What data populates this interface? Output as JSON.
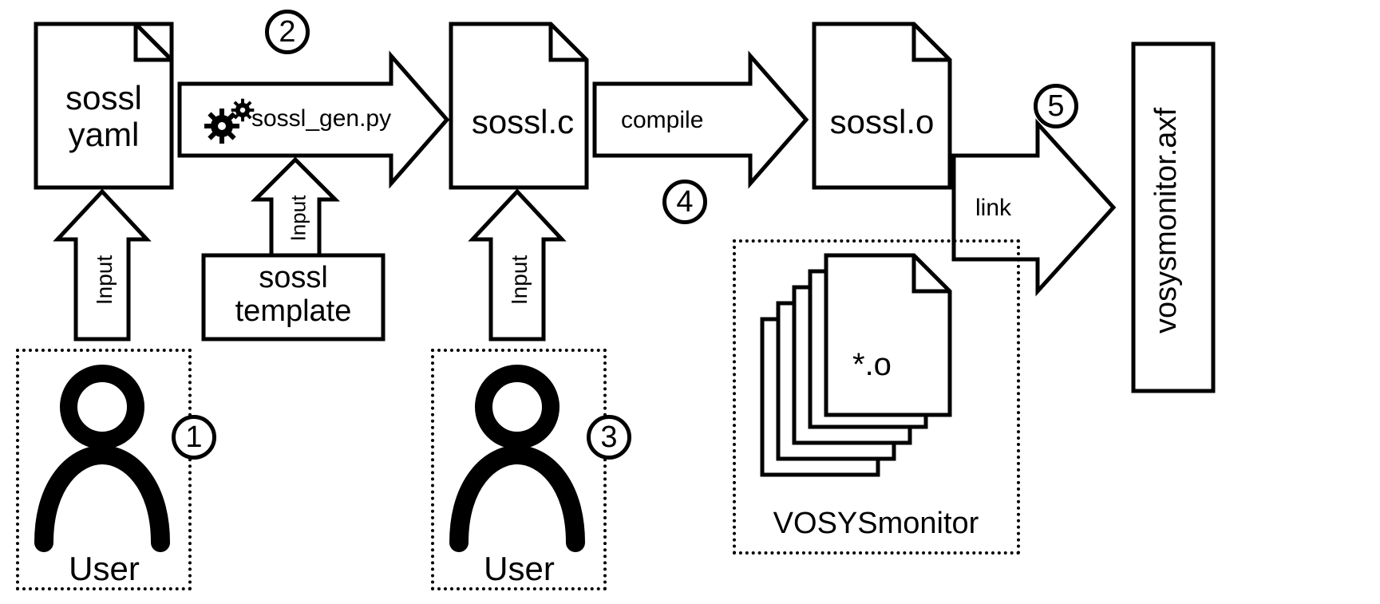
{
  "steps": {
    "s1": "1",
    "s2": "2",
    "s3": "3",
    "s4": "4",
    "s5": "5"
  },
  "files": {
    "yaml": "sossl\nyaml",
    "template": "sossl\ntemplate",
    "sossl_c": "sossl.c",
    "sossl_o": "sossl.o",
    "objs": "*.o",
    "output": "vosysmonitor.axf"
  },
  "arrows": {
    "input": "Input",
    "gen": "sossl_gen.py",
    "compile": "compile",
    "link": "link"
  },
  "actors": {
    "user": "User",
    "vosys": "VOSYSmonitor"
  }
}
